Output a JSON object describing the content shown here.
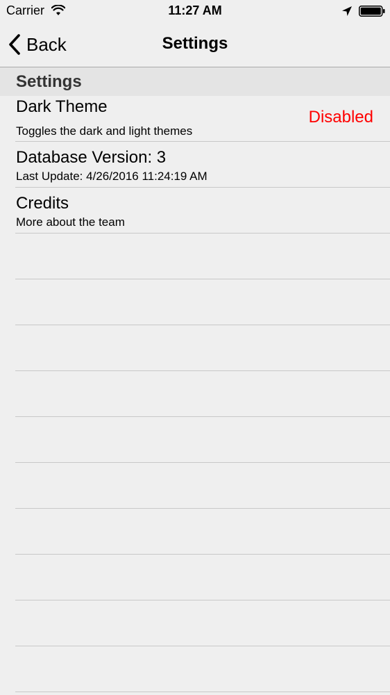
{
  "status_bar": {
    "carrier": "Carrier",
    "time": "11:27 AM",
    "icons": [
      "wifi-icon",
      "location-arrow-icon",
      "battery-icon"
    ]
  },
  "nav": {
    "back_label": "Back",
    "title": "Settings"
  },
  "section": {
    "title": "Settings"
  },
  "rows": [
    {
      "title": "Dark Theme",
      "subtitle": "Toggles the dark and light themes",
      "value": "Disabled",
      "value_color": "#ff0000"
    },
    {
      "title": "Database Version: 3",
      "subtitle": "Last Update: 4/26/2016 11:24:19 AM"
    },
    {
      "title": "Credits",
      "subtitle": "More about the team"
    }
  ],
  "colors": {
    "background": "#efefef",
    "section_header": "#e4e4e4",
    "separator": "#c8c8c8",
    "disabled_value": "#ff0000"
  }
}
